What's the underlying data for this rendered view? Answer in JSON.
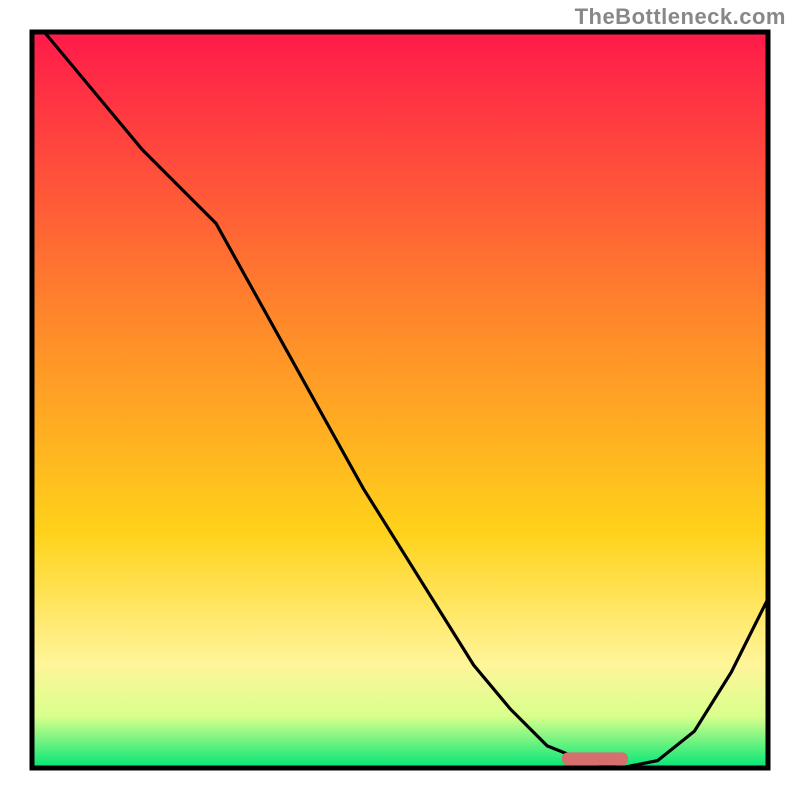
{
  "watermark": "TheBottleneck.com",
  "colors": {
    "frame": "#000000",
    "curve": "#000000",
    "marker": "#d4706e",
    "grad_top": "#ff1a4a",
    "grad_upper_mid": "#ff8a2a",
    "grad_mid": "#ffd21a",
    "grad_lower_mid_a": "#fff59a",
    "grad_lower_mid_b": "#d9ff8c",
    "grad_bottom": "#00e676"
  },
  "chart_data": {
    "type": "line",
    "title": "",
    "xlabel": "",
    "ylabel": "",
    "xlim": [
      0,
      100
    ],
    "ylim": [
      0,
      100
    ],
    "grid": false,
    "legend": false,
    "annotations": [],
    "x": [
      0,
      5,
      10,
      15,
      20,
      25,
      30,
      35,
      40,
      45,
      50,
      55,
      60,
      65,
      70,
      75,
      80,
      85,
      90,
      95,
      100
    ],
    "values": [
      102,
      96,
      90,
      84,
      79,
      74,
      65,
      56,
      47,
      38,
      30,
      22,
      14,
      8,
      3,
      1,
      0,
      1,
      5,
      13,
      23
    ],
    "marker_x_range": [
      72,
      81
    ],
    "marker_y": 1.3,
    "series": [
      {
        "name": "bottleneck-curve",
        "x": [
          0,
          5,
          10,
          15,
          20,
          25,
          30,
          35,
          40,
          45,
          50,
          55,
          60,
          65,
          70,
          75,
          80,
          85,
          90,
          95,
          100
        ],
        "values": [
          102,
          96,
          90,
          84,
          79,
          74,
          65,
          56,
          47,
          38,
          30,
          22,
          14,
          8,
          3,
          1,
          0,
          1,
          5,
          13,
          23
        ]
      }
    ]
  }
}
